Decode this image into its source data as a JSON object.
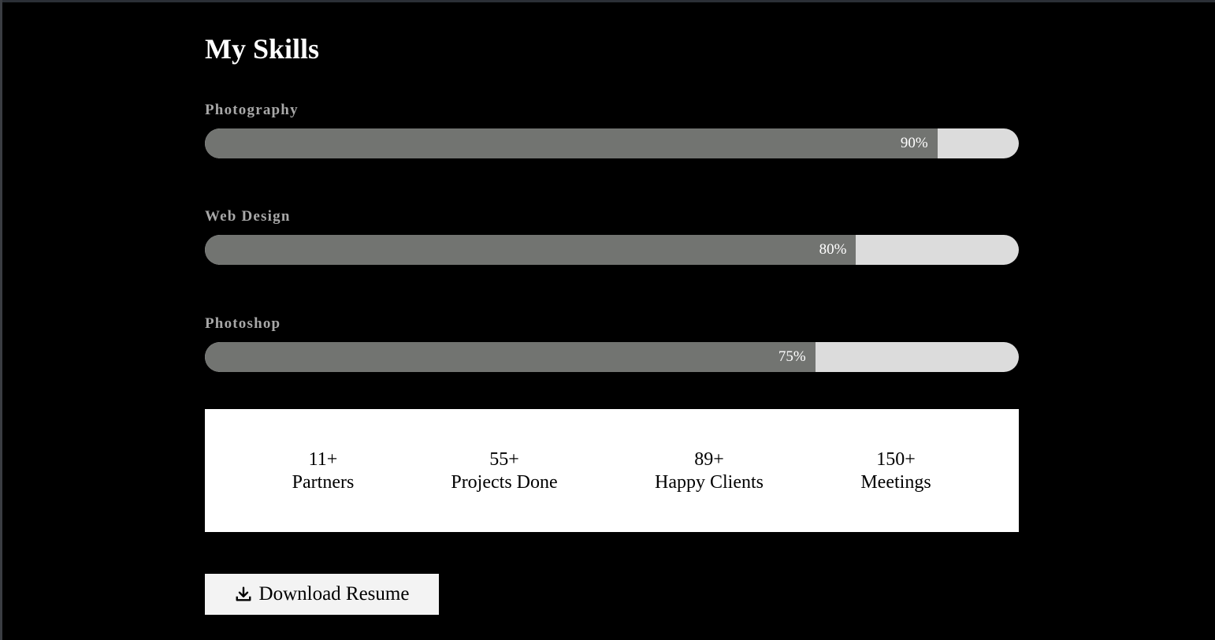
{
  "page": {
    "title": "My Skills"
  },
  "skills": [
    {
      "name": "Photography",
      "percent_label": "90%",
      "level": 0.9
    },
    {
      "name": "Web Design",
      "percent_label": "80%",
      "level": 0.8
    },
    {
      "name": "Photoshop",
      "percent_label": "75%",
      "level": 0.75
    }
  ],
  "stats": [
    {
      "value": "11+",
      "label": "Partners"
    },
    {
      "value": "55+",
      "label": "Projects Done"
    },
    {
      "value": "89+",
      "label": "Happy Clients"
    },
    {
      "value": "150+",
      "label": "Meetings"
    }
  ],
  "download": {
    "label": "Download Resume",
    "icon": "download-icon"
  },
  "colors": {
    "background": "#000000",
    "bar_fill": "#727471",
    "bar_track": "#dcdcdc",
    "stats_panel": "#ffffff",
    "button": "#f3f3f3"
  }
}
